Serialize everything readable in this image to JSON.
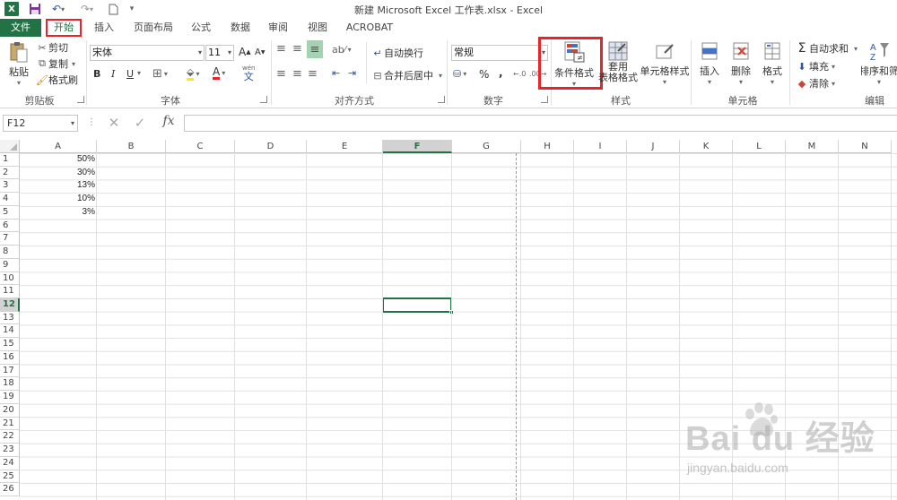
{
  "window": {
    "title": "新建 Microsoft Excel 工作表.xlsx - Excel",
    "app_icon": "X"
  },
  "tabs": [
    "文件",
    "开始",
    "插入",
    "页面布局",
    "公式",
    "数据",
    "审阅",
    "视图",
    "ACROBAT"
  ],
  "ribbon": {
    "clipboard": {
      "paste": "粘贴",
      "cut": "剪切",
      "copy": "复制",
      "format_painter": "格式刷",
      "group": "剪贴板"
    },
    "font": {
      "name": "宋体",
      "size": "11",
      "bold": "B",
      "italic": "I",
      "underline": "U",
      "increase": "A",
      "decrease": "A",
      "font_color": "A",
      "group": "字体",
      "wen": "wén",
      "wen_char": "文"
    },
    "alignment": {
      "wrap": "自动换行",
      "merge": "合并后居中",
      "group": "对齐方式"
    },
    "number": {
      "format": "常规",
      "percent": "%",
      "comma": ",",
      "group": "数字"
    },
    "styles": {
      "conditional": "条件格式",
      "table_line1": "套用",
      "table_line2": "表格格式",
      "cell_styles": "单元格样式",
      "group": "样式"
    },
    "cells": {
      "insert": "插入",
      "delete": "删除",
      "format": "格式",
      "group": "单元格"
    },
    "editing": {
      "autosum": "自动求和",
      "fill": "填充",
      "clear": "清除",
      "sort": "排序和筛",
      "group": "编辑"
    }
  },
  "formula_bar": {
    "name_box": "F12",
    "fx": "fx",
    "value": ""
  },
  "grid": {
    "columns": [
      "A",
      "B",
      "C",
      "D",
      "E",
      "F",
      "G",
      "H",
      "I",
      "J",
      "K",
      "L",
      "M",
      "N"
    ],
    "rows": [
      "1",
      "2",
      "3",
      "4",
      "5",
      "6",
      "7",
      "8",
      "9",
      "10",
      "11",
      "12",
      "13",
      "14",
      "15",
      "16",
      "17",
      "18",
      "19",
      "20",
      "21",
      "22",
      "23",
      "24",
      "25",
      "26"
    ],
    "selected_column": "F",
    "selected_row": "12",
    "column_a_values": [
      "50%",
      "30%",
      "13%",
      "10%",
      "3%"
    ]
  },
  "watermark": {
    "text": "Bai du 经验",
    "url": "jingyan.baidu.com"
  },
  "colors": {
    "accent": "#217346",
    "highlight": "#e8232a"
  }
}
